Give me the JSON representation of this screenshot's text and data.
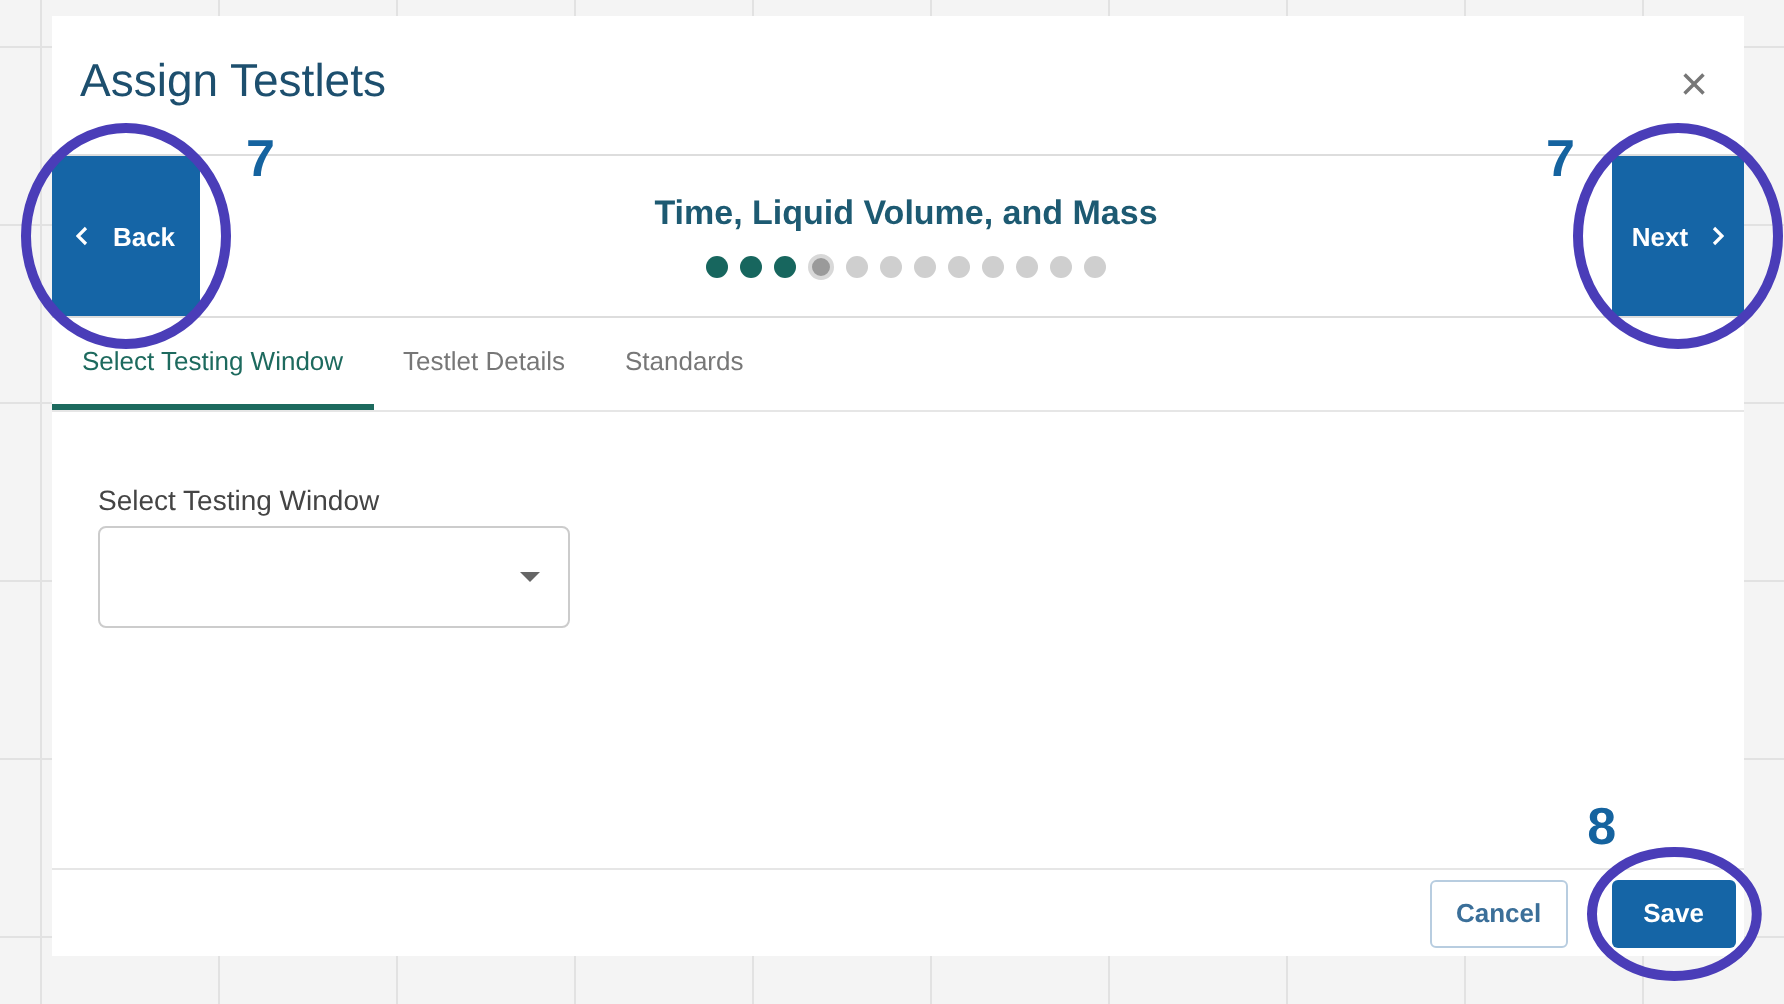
{
  "dialog": {
    "title": "Assign Testlets",
    "close": "×"
  },
  "stepper": {
    "back": {
      "label": "Back",
      "annotation": "7"
    },
    "next": {
      "label": "Next",
      "annotation": "7"
    },
    "title": "Time, Liquid Volume, and Mass",
    "steps": [
      {
        "done": true,
        "selected": false
      },
      {
        "done": true,
        "selected": false
      },
      {
        "done": true,
        "selected": false
      },
      {
        "done": false,
        "selected": true
      },
      {
        "done": false,
        "selected": false
      },
      {
        "done": false,
        "selected": false
      },
      {
        "done": false,
        "selected": false
      },
      {
        "done": false,
        "selected": false
      },
      {
        "done": false,
        "selected": false
      },
      {
        "done": false,
        "selected": false
      },
      {
        "done": false,
        "selected": false
      },
      {
        "done": false,
        "selected": false
      }
    ]
  },
  "tabs": [
    {
      "label": "Select Testing Window",
      "selected": true
    },
    {
      "label": "Testlet Details",
      "selected": false
    },
    {
      "label": "Standards",
      "selected": false
    }
  ],
  "form": {
    "label": "Select Testing Window"
  },
  "buttons": [
    {
      "label": "Cancel",
      "kind": "secondary"
    },
    {
      "label": "Save",
      "kind": "primary",
      "annotation": "8"
    }
  ]
}
